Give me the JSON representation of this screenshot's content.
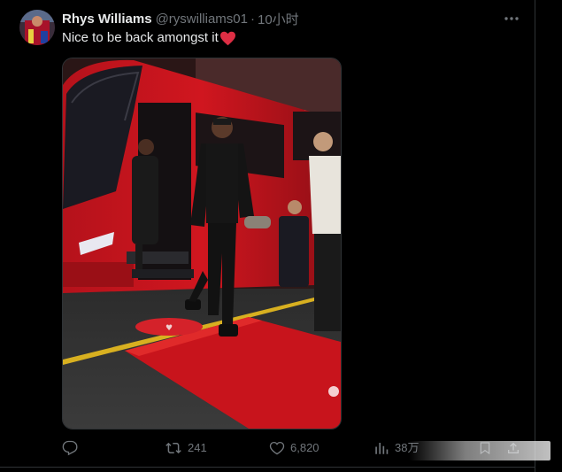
{
  "author": {
    "display_name": "Rhys Williams",
    "handle": "@ryswilliams01",
    "separator": "·",
    "time": "10小时"
  },
  "tweet": {
    "text": "Nice to be back amongst it",
    "emoji": "red-heart"
  },
  "media": {
    "kind": "photo",
    "subject": "player stepping off red team coach onto red carpet"
  },
  "actions": {
    "reply_count": "",
    "retweet_count": "241",
    "like_count": "6,820",
    "view_count": "38万"
  },
  "colors": {
    "background": "#000000",
    "primary_text": "#e7e9ea",
    "secondary_text": "#71767b",
    "border": "#2f3336",
    "heart": "#f91880",
    "bus_red": "#c4161c"
  }
}
